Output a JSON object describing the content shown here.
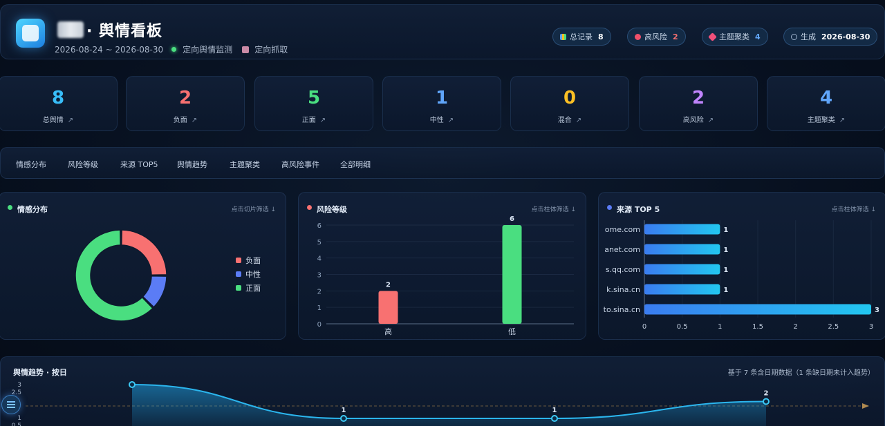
{
  "header": {
    "title": "· 舆情看板",
    "date_range": "2026-08-24 ~ 2026-08-30",
    "monitor_label": "定向舆情监测",
    "crawl_label": "定向抓取",
    "badges": [
      {
        "label": "总记录",
        "value": "8",
        "icon": "chart-icon",
        "value_color": "#ffffff"
      },
      {
        "label": "高风险",
        "value": "2",
        "icon": "red-dot-icon",
        "value_color": "#f87171"
      },
      {
        "label": "主题聚类",
        "value": "4",
        "icon": "pin-icon",
        "value_color": "#60a5fa"
      },
      {
        "label": "生成",
        "value": "2026-08-30",
        "icon": "clock-icon",
        "value_color": "#ffffff"
      }
    ]
  },
  "stats": [
    {
      "value": "8",
      "label": "总舆情",
      "color": "#38bdf8"
    },
    {
      "value": "2",
      "label": "负面",
      "color": "#f87171"
    },
    {
      "value": "5",
      "label": "正面",
      "color": "#4ade80"
    },
    {
      "value": "1",
      "label": "中性",
      "color": "#60a5fa"
    },
    {
      "value": "0",
      "label": "混合",
      "color": "#fbbf24"
    },
    {
      "value": "2",
      "label": "高风险",
      "color": "#c084fc"
    },
    {
      "value": "4",
      "label": "主题聚类",
      "color": "#60a5fa"
    }
  ],
  "stat_arrow": "↗",
  "tabs": [
    "情感分布",
    "风险等级",
    "来源 TOP5",
    "舆情趋势",
    "主题聚类",
    "高风险事件",
    "全部明细"
  ],
  "sentiment_panel": {
    "title": "情感分布",
    "hint": "点击切片筛选 ↓"
  },
  "risk_panel": {
    "title": "风险等级",
    "hint": "点击柱体筛选 ↓"
  },
  "source_panel": {
    "title": "来源 TOP 5",
    "hint": "点击柱体筛选 ↓"
  },
  "trend_panel": {
    "title": "舆情趋势 · 按日",
    "note": "基于 7 条含日期数据（1 条缺日期未计入趋势）"
  },
  "chart_data": [
    {
      "type": "pie",
      "title": "情感分布",
      "categories": [
        "负面",
        "中性",
        "正面"
      ],
      "values": [
        2,
        1,
        5
      ],
      "colors": [
        "#f87171",
        "#5b7cf5",
        "#4ade80"
      ]
    },
    {
      "type": "bar",
      "title": "风险等级",
      "categories": [
        "高",
        "低"
      ],
      "values": [
        2,
        6
      ],
      "colors": [
        "#f87171",
        "#4ade80"
      ],
      "ylim": [
        0,
        6
      ],
      "yticks": [
        0,
        1,
        2,
        3,
        4,
        5,
        6
      ],
      "grid": true
    },
    {
      "type": "bar",
      "orientation": "horizontal",
      "title": "来源 TOP 5",
      "categories": [
        "ome.com",
        "anet.com",
        "s.qq.com",
        "k.sina.cn",
        "to.sina.cn"
      ],
      "values": [
        1,
        1,
        1,
        1,
        3
      ],
      "xlim": [
        0,
        3
      ],
      "xticks": [
        "0",
        "0.5",
        "1",
        "1.5",
        "2",
        "2.5",
        "3"
      ]
    },
    {
      "type": "line",
      "title": "舆情趋势 · 按日",
      "points": [
        {
          "y": 3,
          "label": ""
        },
        {
          "y": 1,
          "label": "1"
        },
        {
          "y": 1,
          "label": "1"
        },
        {
          "y": 2,
          "label": "2"
        }
      ],
      "yticks": [
        "3",
        "2.5",
        "1",
        "0.5"
      ]
    }
  ]
}
